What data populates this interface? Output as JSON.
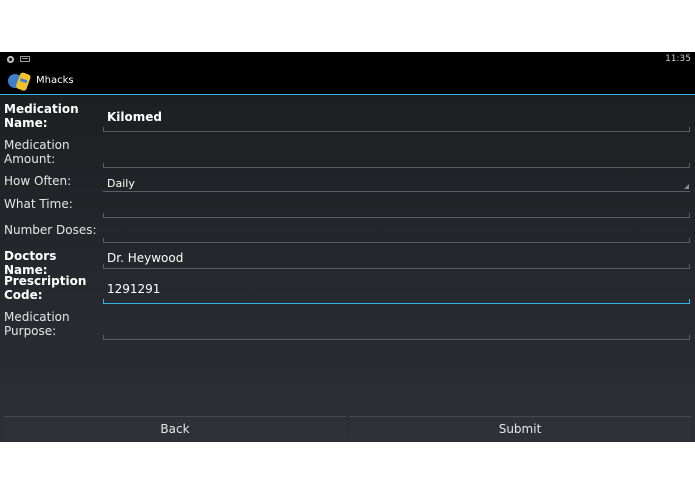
{
  "status_bar": {
    "time": "11:35",
    "icons": [
      "settings-icon",
      "keyboard-icon"
    ]
  },
  "action_bar": {
    "title": "Mhacks",
    "icon": "app-logo-icon"
  },
  "form": {
    "fields": [
      {
        "label": "Medication Name:",
        "value": "Kilomed"
      },
      {
        "label": "Medication Amount:",
        "value": ""
      },
      {
        "label": "How Often:",
        "value": "Daily"
      },
      {
        "label": "What Time:",
        "value": ""
      },
      {
        "label": "Number Doses:",
        "value": ""
      },
      {
        "label": "Doctors Name:",
        "value": "Dr. Heywood"
      },
      {
        "label": "Prescription Code:",
        "value": "1291291"
      },
      {
        "label": "Medication Purpose:",
        "value": ""
      }
    ]
  },
  "buttons": {
    "back": "Back",
    "submit": "Submit"
  },
  "colors": {
    "accent": "#33b5e5",
    "background": "#1f2226"
  }
}
